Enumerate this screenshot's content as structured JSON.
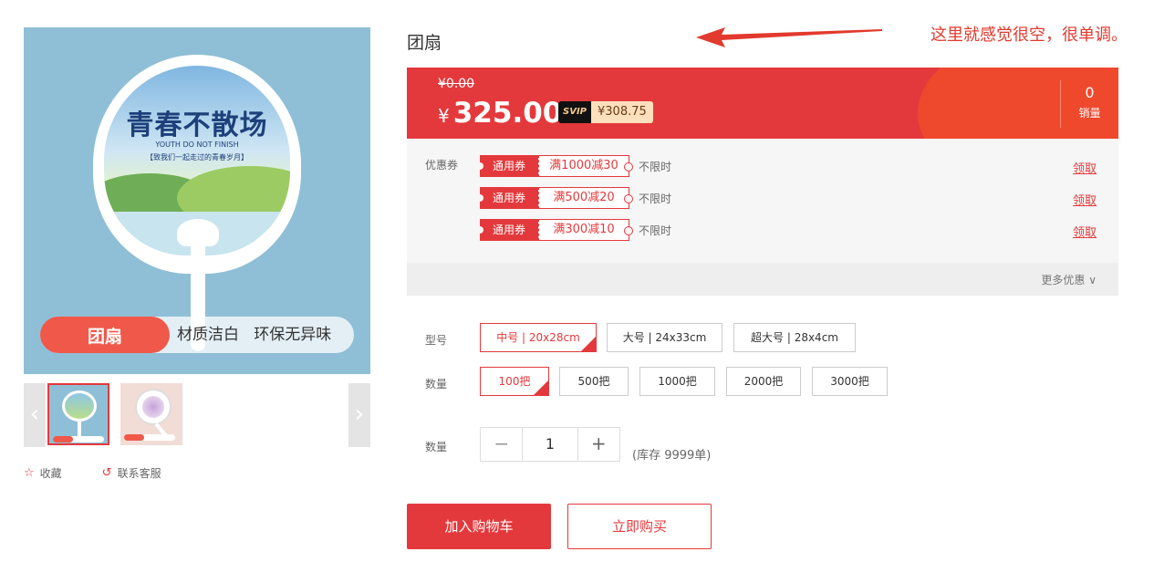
{
  "gallery": {
    "fan_title": "青春不散场",
    "fan_subtitle": "YOUTH DO NOT FINISH",
    "fan_slogan": "【致我们一起走过的青春岁月】",
    "tag_name": "团扇",
    "tag_desc": "材质洁白   环保无异味",
    "prev_icon": "‹",
    "next_icon": "›"
  },
  "actions": {
    "favorite_label": "收藏",
    "service_label": "联系客服"
  },
  "product": {
    "title": "团扇",
    "annotation": "这里就感觉很空，很单调。"
  },
  "price": {
    "old_price": "¥0.00",
    "currency": "¥",
    "current": "325.00",
    "svip_tag": "SVIP",
    "svip_price": "¥308.75",
    "sales_count": "0",
    "sales_label": "销量"
  },
  "coupons": {
    "label": "优惠券",
    "items": [
      {
        "type": "通用券",
        "rule": "满1000减30",
        "limit": "不限时",
        "claim": "领取"
      },
      {
        "type": "通用券",
        "rule": "满500减20",
        "limit": "不限时",
        "claim": "领取"
      },
      {
        "type": "通用券",
        "rule": "满300减10",
        "limit": "不限时",
        "claim": "领取"
      }
    ],
    "more": "更多优惠 ∨"
  },
  "specs": {
    "model_label": "型号",
    "models": [
      "中号 | 20x28cm",
      "大号 | 24x33cm",
      "超大号 | 28x4cm"
    ],
    "count_label": "数量",
    "counts": [
      "100把",
      "500把",
      "1000把",
      "2000把",
      "3000把"
    ],
    "check": "✓"
  },
  "quantity": {
    "label": "数量",
    "minus": "−",
    "value": "1",
    "plus": "+",
    "stock": "(库存 9999单)"
  },
  "buttons": {
    "cart": "加入购物车",
    "buy": "立即购买"
  },
  "colors": {
    "accent": "#e4393c",
    "annotation": "#e23a2e"
  }
}
